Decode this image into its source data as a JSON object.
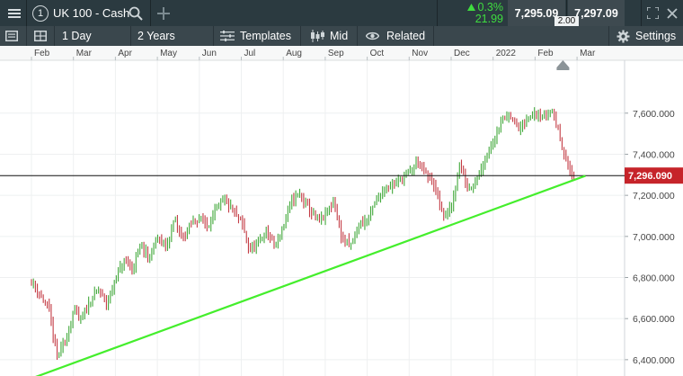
{
  "header": {
    "instrument_number": "1",
    "instrument_name": "UK 100 - Cash",
    "change_percent": "0.3%",
    "change_points": "21.99",
    "sell_price": "7,295.09",
    "buy_price": "7,297.09",
    "spread": "2.00"
  },
  "toolbar": {
    "interval": "1 Day",
    "range": "2 Years",
    "templates_label": "Templates",
    "price_type": "Mid",
    "related_label": "Related",
    "settings_label": "Settings"
  },
  "chart_data": {
    "type": "candlestick",
    "months": [
      "Feb",
      "Mar",
      "Apr",
      "May",
      "Jun",
      "Jul",
      "Aug",
      "Sep",
      "Oct",
      "Nov",
      "Dec",
      "2022",
      "Feb",
      "Mar"
    ],
    "y_ticks": [
      "7,600.000",
      "7,400.000",
      "7,200.000",
      "7,000.000",
      "6,800.000",
      "6,600.000",
      "6,400.000"
    ],
    "ylim": [
      6340,
      7680
    ],
    "current_price_label": "7,296.090",
    "current_price": 7296.09,
    "trendline": [
      {
        "month_index": -0.05,
        "value": 6305
      },
      {
        "month_index": 13.2,
        "value": 7295
      }
    ],
    "close_path": [
      [
        0.0,
        6780
      ],
      [
        0.2,
        6720
      ],
      [
        0.4,
        6650
      ],
      [
        0.6,
        6420
      ],
      [
        0.8,
        6480
      ],
      [
        1.0,
        6640
      ],
      [
        1.2,
        6590
      ],
      [
        1.4,
        6690
      ],
      [
        1.6,
        6740
      ],
      [
        1.8,
        6670
      ],
      [
        2.0,
        6790
      ],
      [
        2.2,
        6880
      ],
      [
        2.4,
        6840
      ],
      [
        2.6,
        6960
      ],
      [
        2.8,
        6890
      ],
      [
        3.0,
        7000
      ],
      [
        3.2,
        6940
      ],
      [
        3.4,
        7080
      ],
      [
        3.6,
        6990
      ],
      [
        3.8,
        7060
      ],
      [
        4.0,
        7090
      ],
      [
        4.2,
        7050
      ],
      [
        4.4,
        7130
      ],
      [
        4.6,
        7180
      ],
      [
        4.8,
        7120
      ],
      [
        5.0,
        7070
      ],
      [
        5.2,
        6930
      ],
      [
        5.4,
        6960
      ],
      [
        5.6,
        7030
      ],
      [
        5.8,
        6950
      ],
      [
        6.0,
        7050
      ],
      [
        6.2,
        7180
      ],
      [
        6.4,
        7200
      ],
      [
        6.6,
        7140
      ],
      [
        6.8,
        7070
      ],
      [
        7.0,
        7100
      ],
      [
        7.2,
        7170
      ],
      [
        7.4,
        6990
      ],
      [
        7.6,
        6950
      ],
      [
        7.8,
        7060
      ],
      [
        8.0,
        7080
      ],
      [
        8.2,
        7170
      ],
      [
        8.4,
        7230
      ],
      [
        8.6,
        7250
      ],
      [
        8.8,
        7280
      ],
      [
        9.0,
        7310
      ],
      [
        9.2,
        7370
      ],
      [
        9.4,
        7300
      ],
      [
        9.6,
        7250
      ],
      [
        9.8,
        7100
      ],
      [
        10.0,
        7130
      ],
      [
        10.2,
        7350
      ],
      [
        10.4,
        7230
      ],
      [
        10.6,
        7280
      ],
      [
        10.8,
        7380
      ],
      [
        11.0,
        7470
      ],
      [
        11.2,
        7560
      ],
      [
        11.4,
        7600
      ],
      [
        11.6,
        7520
      ],
      [
        11.8,
        7560
      ],
      [
        12.0,
        7610
      ],
      [
        12.2,
        7580
      ],
      [
        12.4,
        7620
      ],
      [
        12.6,
        7480
      ],
      [
        12.8,
        7330
      ],
      [
        12.95,
        7280
      ],
      [
        13.0,
        7296
      ]
    ]
  }
}
